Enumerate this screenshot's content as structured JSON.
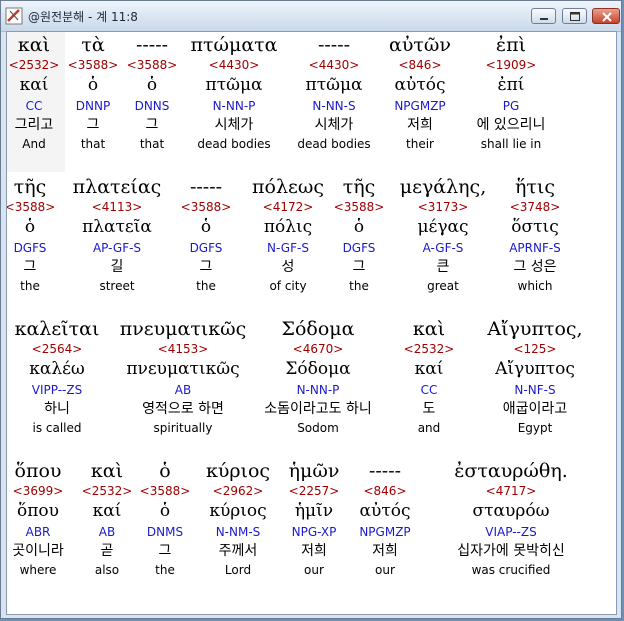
{
  "window": {
    "title": "@원전분해 - 계 11:8"
  },
  "verse_rows": [
    {
      "words": [
        {
          "greek": "καὶ",
          "strong": "<2532>",
          "lemma": "καί",
          "parsing": "CC",
          "korean": "그리고",
          "english": "And"
        },
        {
          "greek": "τὰ",
          "strong": "<3588>",
          "lemma": "ὁ",
          "parsing": "DNNP",
          "korean": "그",
          "english": "that"
        },
        {
          "greek": "-----",
          "strong": "<3588>",
          "lemma": "ὁ",
          "parsing": "DNNS",
          "korean": "그",
          "english": "that"
        },
        {
          "greek": "πτώματα",
          "strong": "<4430>",
          "lemma": "πτῶμα",
          "parsing": "N-NN-P",
          "korean": "시체가",
          "english": "dead bodies"
        },
        {
          "greek": "-----",
          "strong": "<4430>",
          "lemma": "πτῶμα",
          "parsing": "N-NN-S",
          "korean": "시체가",
          "english": "dead bodies"
        },
        {
          "greek": "αὐτῶν",
          "strong": "<846>",
          "lemma": "αὐτός",
          "parsing": "NPGMZP",
          "korean": "저희",
          "english": "their"
        },
        {
          "greek": "ἐπὶ",
          "strong": "<1909>",
          "lemma": "ἐπί",
          "parsing": "PG",
          "korean": "에 있으리니",
          "english": "shall lie in"
        }
      ]
    },
    {
      "words": [
        {
          "greek": "τῆς",
          "strong": "<3588>",
          "lemma": "ὁ",
          "parsing": "DGFS",
          "korean": "그",
          "english": "the"
        },
        {
          "greek": "πλατείας",
          "strong": "<4113>",
          "lemma": "πλατεῖα",
          "parsing": "AP-GF-S",
          "korean": "길",
          "english": "street"
        },
        {
          "greek": "-----",
          "strong": "<3588>",
          "lemma": "ὁ",
          "parsing": "DGFS",
          "korean": "그",
          "english": "the"
        },
        {
          "greek": "πόλεως",
          "strong": "<4172>",
          "lemma": "πόλις",
          "parsing": "N-GF-S",
          "korean": "성",
          "english": "of city"
        },
        {
          "greek": "τῆς",
          "strong": "<3588>",
          "lemma": "ὁ",
          "parsing": "DGFS",
          "korean": "그",
          "english": "the"
        },
        {
          "greek": "μεγάλης,",
          "strong": "<3173>",
          "lemma": "μέγας",
          "parsing": "A-GF-S",
          "korean": "큰",
          "english": "great"
        },
        {
          "greek": "ἥτις",
          "strong": "<3748>",
          "lemma": "ὅστις",
          "parsing": "APRNF-S",
          "korean": "그 성은",
          "english": "which"
        }
      ]
    },
    {
      "words": [
        {
          "greek": "καλεῖται",
          "strong": "<2564>",
          "lemma": "καλέω",
          "parsing": "VIPP--ZS",
          "korean": "하니",
          "english": "is called"
        },
        {
          "greek": "πνευματικῶς",
          "strong": "<4153>",
          "lemma": "πνευματικῶς",
          "parsing": "AB",
          "korean": "영적으로 하면",
          "english": "spiritually"
        },
        {
          "greek": "Σόδομα",
          "strong": "<4670>",
          "lemma": "Σόδομα",
          "parsing": "N-NN-P",
          "korean": "소돔이라고도 하니",
          "english": "Sodom"
        },
        {
          "greek": "καὶ",
          "strong": "<2532>",
          "lemma": "καί",
          "parsing": "CC",
          "korean": "도",
          "english": "and"
        },
        {
          "greek": "Αἴγυπτος,",
          "strong": "<125>",
          "lemma": "Αἴγυπτος",
          "parsing": "N-NF-S",
          "korean": "애굽이라고",
          "english": "Egypt"
        }
      ]
    },
    {
      "words": [
        {
          "greek": "ὅπου",
          "strong": "<3699>",
          "lemma": "ὅπου",
          "parsing": "ABR",
          "korean": "곳이니라",
          "english": "where"
        },
        {
          "greek": "καὶ",
          "strong": "<2532>",
          "lemma": "καί",
          "parsing": "AB",
          "korean": "곧",
          "english": "also"
        },
        {
          "greek": "ὁ",
          "strong": "<3588>",
          "lemma": "ὁ",
          "parsing": "DNMS",
          "korean": "그",
          "english": "the"
        },
        {
          "greek": "κύριος",
          "strong": "<2962>",
          "lemma": "κύριος",
          "parsing": "N-NM-S",
          "korean": "주께서",
          "english": "Lord"
        },
        {
          "greek": "ἡμῶν",
          "strong": "<2257>",
          "lemma": "ἡμῖν",
          "parsing": "NPG-XP",
          "korean": "저희",
          "english": "our"
        },
        {
          "greek": "-----",
          "strong": "<846>",
          "lemma": "αὐτός",
          "parsing": "NPGMZP",
          "korean": "저희",
          "english": "our"
        },
        {
          "greek": "ἐσταυρώθη.",
          "strong": "<4717>",
          "lemma": "σταυρόω",
          "parsing": "VIAP--ZS",
          "korean": "십자가에 못박히신",
          "english": "was crucified"
        }
      ]
    }
  ]
}
